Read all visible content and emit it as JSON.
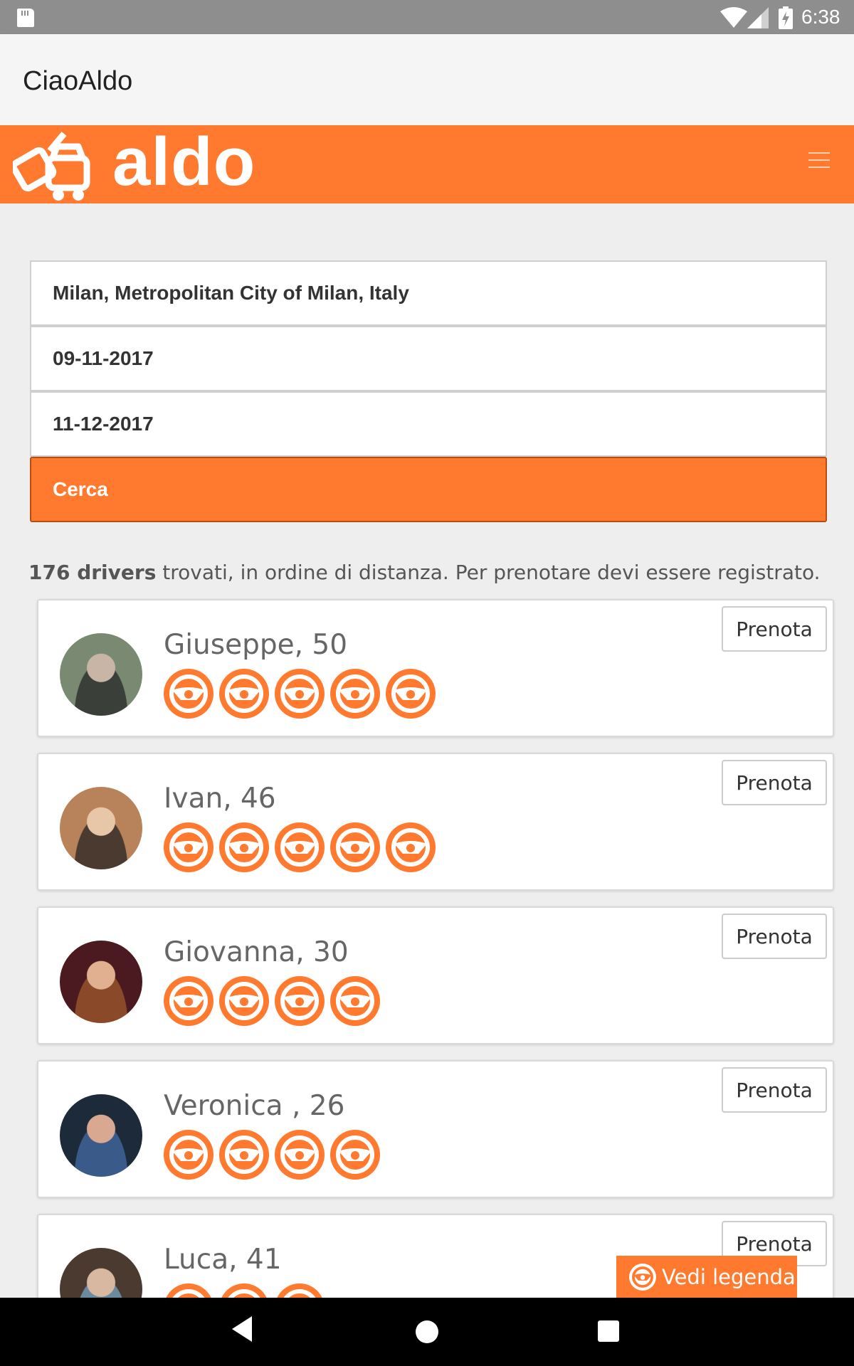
{
  "status_bar": {
    "time": "6:38",
    "icons": [
      "sd-card-icon",
      "wifi-icon",
      "signal-icon",
      "battery-charging-icon"
    ]
  },
  "app_bar": {
    "title": "CiaoAldo"
  },
  "site_header": {
    "logo_text": "aldo",
    "menu_icon": "hamburger-menu-icon",
    "brand_color": "#ff7a2f"
  },
  "search": {
    "location": "Milan, Metropolitan City of Milan, Italy",
    "start_date": "09-11-2017",
    "end_date": "11-12-2017",
    "submit_label": "Cerca"
  },
  "results": {
    "count_label": "176 drivers",
    "summary_text": " trovati, in ordine di distanza. Per prenotare devi essere registrato."
  },
  "drivers": [
    {
      "name": "Giuseppe, 50",
      "rating": 5,
      "book_label": "Prenota"
    },
    {
      "name": "Ivan, 46",
      "rating": 5,
      "book_label": "Prenota"
    },
    {
      "name": "Giovanna, 30",
      "rating": 4,
      "book_label": "Prenota"
    },
    {
      "name": "Veronica , 26",
      "rating": 4,
      "book_label": "Prenota"
    },
    {
      "name": "Luca, 41",
      "rating": 3,
      "book_label": "Prenota"
    }
  ],
  "legend_button": {
    "label": "Vedi legenda",
    "icon": "steering-wheel-icon"
  },
  "nav_bar": {
    "icons": [
      "back-icon",
      "home-icon",
      "recents-icon"
    ]
  }
}
